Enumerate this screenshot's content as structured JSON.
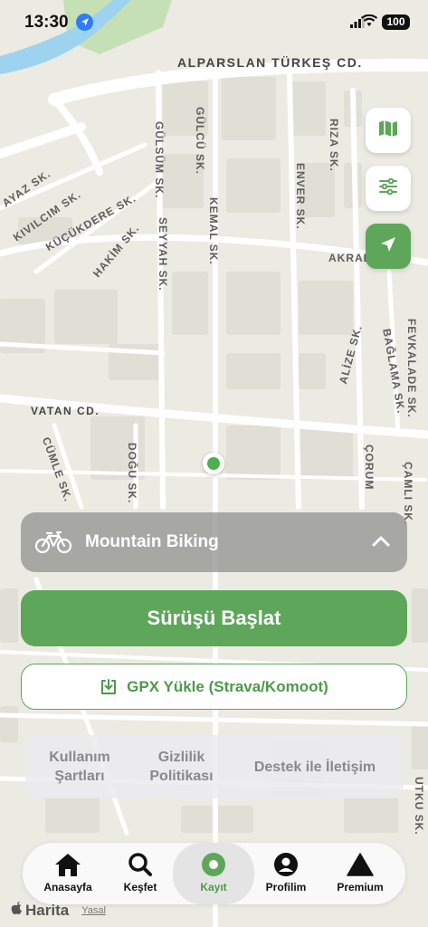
{
  "status_bar": {
    "time": "13:30",
    "battery": "100"
  },
  "map": {
    "streets": [
      {
        "name": "ALPARSLAN TÜRKEŞ CD."
      },
      {
        "name": "GÜLCÜ SK."
      },
      {
        "name": "RIZA SK."
      },
      {
        "name": "GÜLSÜM SK."
      },
      {
        "name": "ENVER SK."
      },
      {
        "name": "AYAZ SK."
      },
      {
        "name": "KIVILCIM SK."
      },
      {
        "name": "KÜÇÜKDERE SK."
      },
      {
        "name": "HAKİM SK."
      },
      {
        "name": "SEYYAH SK."
      },
      {
        "name": "KEMAL SK."
      },
      {
        "name": "AKRAB"
      },
      {
        "name": "ALİZE SK."
      },
      {
        "name": "BAĞLAMA SK."
      },
      {
        "name": "FEVKALADE SK."
      },
      {
        "name": "VATAN CD."
      },
      {
        "name": "CÜMLE SK."
      },
      {
        "name": "DOĞU SK."
      },
      {
        "name": "ÇORUM"
      },
      {
        "name": "ÇAMLI SK."
      },
      {
        "name": "UTKU SK."
      }
    ]
  },
  "activity": {
    "label": "Mountain Biking"
  },
  "actions": {
    "start_label": "Sürüşü Başlat",
    "gpx_label": "GPX Yükle (Strava/Komoot)"
  },
  "footer_links": {
    "terms_1": "Kullanım",
    "terms_2": "Şartları",
    "privacy_1": "Gizlilik",
    "privacy_2": "Politikası",
    "contact": "Destek ile İletişim"
  },
  "tabs": [
    {
      "label": "Anasayfa",
      "icon": "home-icon"
    },
    {
      "label": "Keşfet",
      "icon": "search-icon"
    },
    {
      "label": "Kayıt",
      "icon": "record-icon"
    },
    {
      "label": "Profilim",
      "icon": "profile-icon"
    },
    {
      "label": "Premium",
      "icon": "triangle-icon"
    }
  ],
  "legal": {
    "maps": "Harita",
    "yasal": "Yasal"
  },
  "colors": {
    "accent": "#5ea65a",
    "map_bg": "#ecebe3",
    "road": "#ffffff"
  }
}
